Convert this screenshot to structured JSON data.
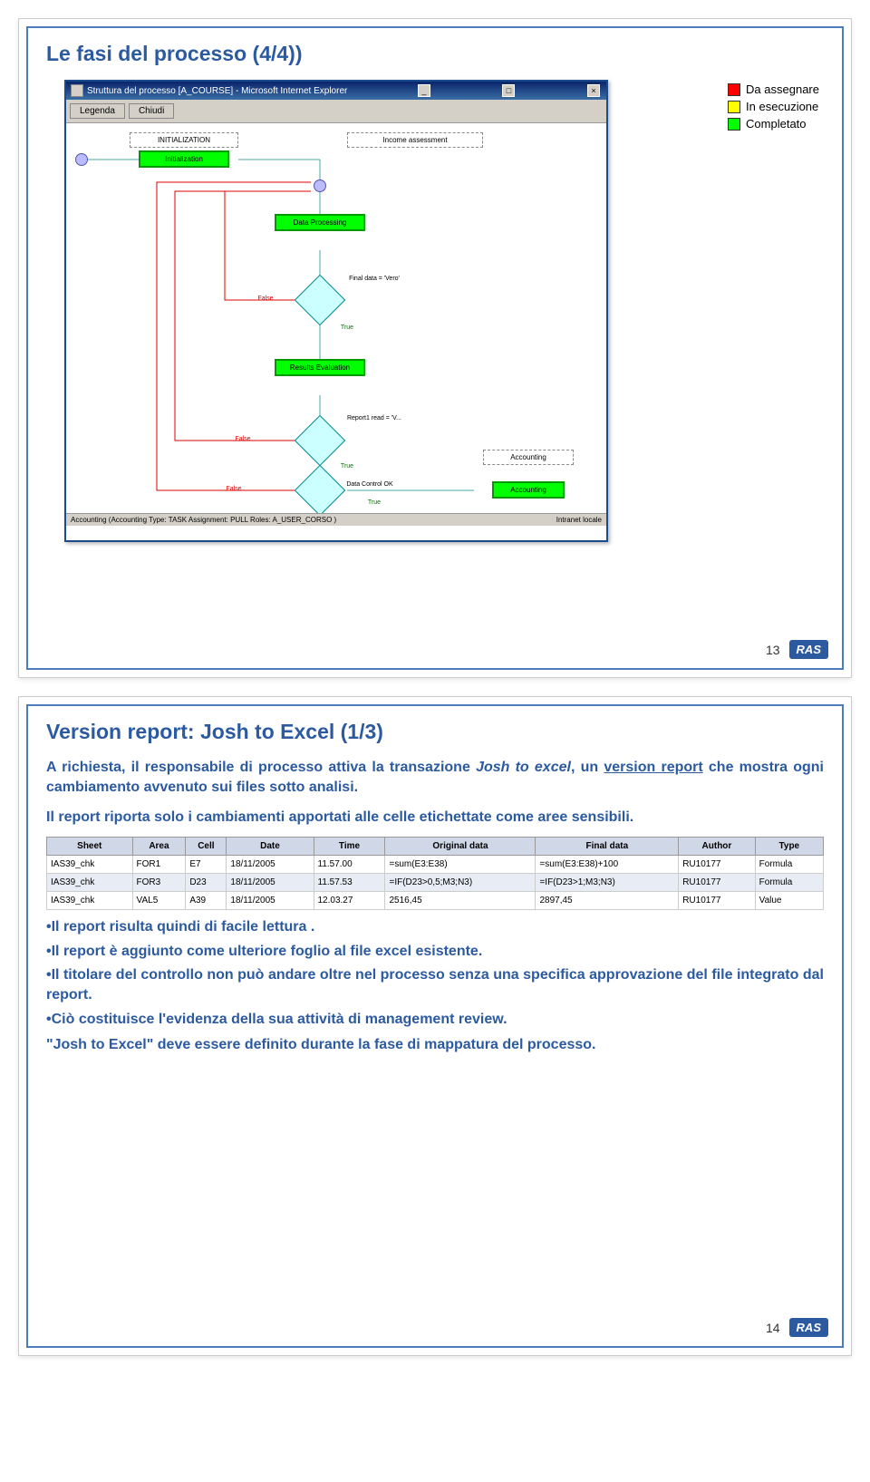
{
  "slide1": {
    "title": "Le fasi del processo  (4/4))",
    "legend": {
      "red": "Da assegnare",
      "yellow": "In esecuzione",
      "green": "Completato"
    },
    "window": {
      "title": "Struttura del processo [A_COURSE] - Microsoft Internet Explorer",
      "btn_legend": "Legenda",
      "btn_close": "Chiudi",
      "status_left": "Accounting (Accounting  Type: TASK  Assignment: PULL  Roles:  A_USER_CORSO )",
      "status_right": "Intranet locale"
    },
    "boxes": {
      "init": "INITIALIZATION",
      "init2": "Initialization",
      "income": "Income assessment",
      "datap": "Data Processing",
      "results": "Results Evaluation",
      "acct": "Accounting",
      "acct2": "Accounting"
    },
    "diamonds": {
      "final": "Final data = 'Vero'",
      "report": "Report1 read = 'V...",
      "control": "Data Control OK"
    },
    "labels": {
      "true": "True",
      "false": "False"
    },
    "page": "13"
  },
  "slide2": {
    "title": "Version report: Josh to Excel  (1/3)",
    "p1a": "A richiesta, il responsabile di processo attiva la transazione ",
    "p1b": "Josh to excel",
    "p1c": ", un ",
    "p1d": "version report",
    "p1e": " che mostra ogni cambiamento avvenuto sui files sotto analisi.",
    "p2": "Il report riporta solo i cambiamenti apportati alle celle etichettate come aree sensibili.",
    "table": {
      "headers": [
        "Sheet",
        "Area",
        "Cell",
        "Date",
        "Time",
        "Original data",
        "Final data",
        "Author",
        "Type"
      ],
      "rows": [
        [
          "IAS39_chk",
          "FOR1",
          "E7",
          "18/11/2005",
          "11.57.00",
          "=sum(E3:E38)",
          "=sum(E3:E38)+100",
          "RU10177",
          "Formula"
        ],
        [
          "IAS39_chk",
          "FOR3",
          "D23",
          "18/11/2005",
          "11.57.53",
          "=IF(D23>0,5;M3;N3)",
          "=IF(D23>1;M3;N3)",
          "RU10177",
          "Formula"
        ],
        [
          "IAS39_chk",
          "VAL5",
          "A39",
          "18/11/2005",
          "12.03.27",
          "2516,45",
          "2897,45",
          "RU10177",
          "Value"
        ]
      ]
    },
    "b1": "•Il report risulta quindi di facile lettura .",
    "b2": "•Il report è aggiunto come ulteriore foglio al file excel esistente.",
    "b3": "•Il titolare del controllo non può andare oltre nel processo senza una specifica approvazione del file integrato dal report.",
    "b4": "•Ciò costituisce l'evidenza della sua attività di management review.",
    "last": "\"Josh to Excel\" deve essere definito durante la fase di mappatura del processo.",
    "page": "14"
  },
  "logo": "RAS"
}
